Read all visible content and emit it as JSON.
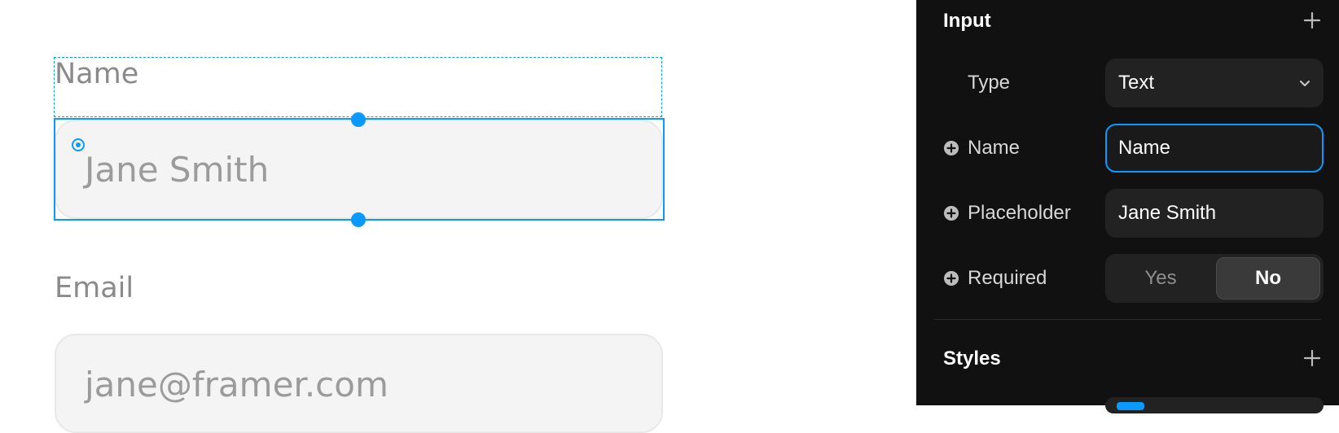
{
  "canvas": {
    "name_field": {
      "label": "Name",
      "placeholder": "Jane Smith"
    },
    "email_field": {
      "label": "Email",
      "placeholder": "jane@framer.com"
    }
  },
  "panel": {
    "input_section": {
      "title": "Input",
      "add_icon": "plus-icon",
      "rows": {
        "type": {
          "label": "Type",
          "value": "Text"
        },
        "name": {
          "label": "Name",
          "value": "Name"
        },
        "placeholder": {
          "label": "Placeholder",
          "value": "Jane Smith"
        },
        "required": {
          "label": "Required",
          "options": [
            "Yes",
            "No"
          ],
          "selected": "No"
        }
      }
    },
    "styles_section": {
      "title": "Styles",
      "add_icon": "plus-icon"
    }
  },
  "colors": {
    "accent": "#0a99ff",
    "panel_bg": "#111111",
    "control_bg": "#222222",
    "field_bg": "#f4f4f4"
  }
}
